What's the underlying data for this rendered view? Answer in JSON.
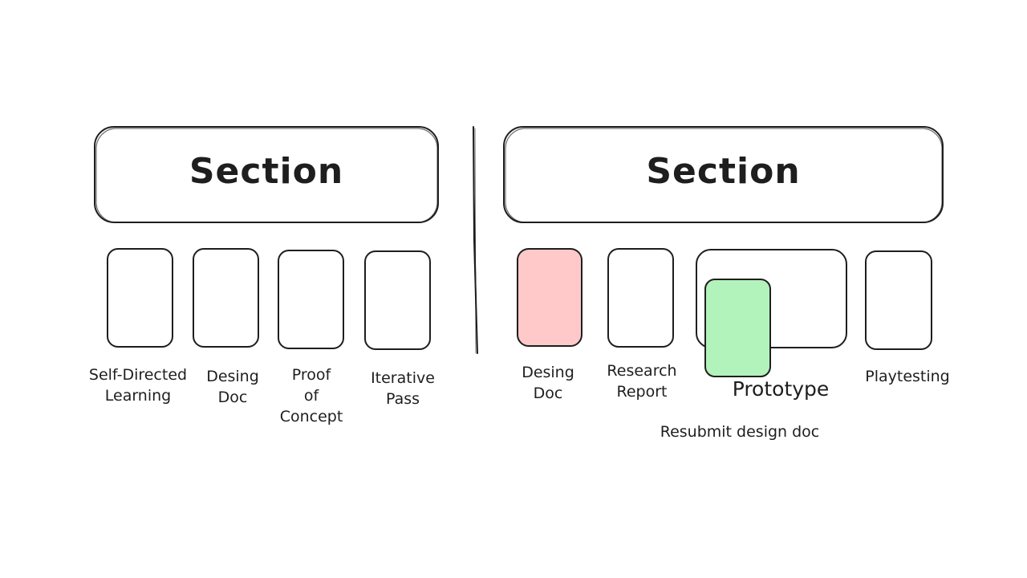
{
  "left": {
    "section_title": "Section",
    "cards": [
      {
        "line1": "Self-Directed",
        "line2": "Learning",
        "line3": ""
      },
      {
        "line1": "Desing",
        "line2": "Doc",
        "line3": ""
      },
      {
        "line1": "Proof",
        "line2": "of",
        "line3": "Concept"
      },
      {
        "line1": "Iterative",
        "line2": "Pass",
        "line3": ""
      }
    ]
  },
  "right": {
    "section_title": "Section",
    "cards": [
      {
        "line1": "Desing",
        "line2": "Doc",
        "fill": "#ffc9c9"
      },
      {
        "line1": "Research",
        "line2": "Report",
        "fill": "none"
      },
      {
        "line1": "Prototype",
        "line2": "",
        "fill": "none"
      },
      {
        "line1": "Playtesting",
        "line2": "",
        "fill": "none"
      }
    ],
    "note": "Resubmit design doc"
  },
  "colors": {
    "stroke": "#1e1e1e",
    "highlight_red": "#ffc9c9",
    "highlight_green": "#b2f2bb"
  }
}
